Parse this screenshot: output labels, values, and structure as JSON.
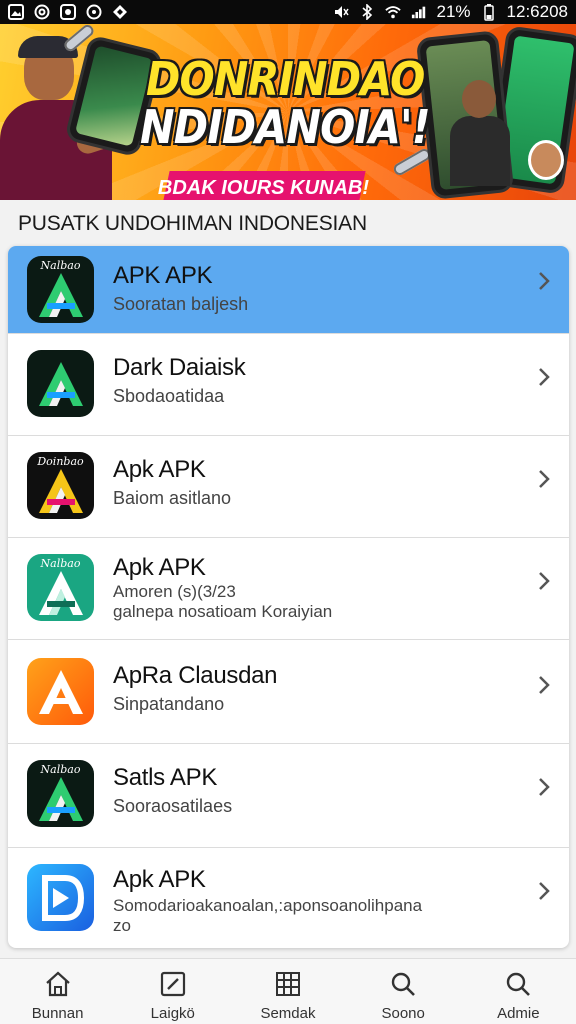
{
  "status_bar": {
    "left_icons": [
      "gallery-icon",
      "at-icon",
      "record-icon",
      "circle-icon",
      "diamond-icon"
    ],
    "battery_text": "21%",
    "time": "12:6208"
  },
  "banner": {
    "title_line1": "DONRINDAO",
    "title_line2": "NDIDANOIA'!",
    "pill_text": "BDAK IOURS KUNAB!"
  },
  "section": {
    "title": "PUSATK UNDOHIMAN INDONESIAN"
  },
  "apps": [
    {
      "name": "APK APK",
      "subtitle": "Sooratan baljesh",
      "icon_label": "Nalbao",
      "icon_bg": "#0b1a14",
      "selected": true
    },
    {
      "name": "Dark Daiaisk",
      "subtitle": "Sbodaoatidaa",
      "icon_label": "",
      "icon_bg": "#0b1a14",
      "selected": false
    },
    {
      "name": "Apk APK",
      "subtitle": "Baiom asitlano",
      "icon_label": "Doinbao",
      "icon_bg": "#0f0f0f",
      "selected": false
    },
    {
      "name": "Apk APK",
      "subtitle": "Amoren (s)(3/23\ngalnepa nosatioam Koraiyian",
      "icon_label": "Nalbao",
      "icon_bg": "#1aa682",
      "selected": false
    },
    {
      "name": "ApRa Clausdan",
      "subtitle": "Sinpatandano",
      "icon_label": "",
      "icon_bg": "#ff7a12",
      "selected": false
    },
    {
      "name": "Satls APK",
      "subtitle": "Sooraosatilaes",
      "icon_label": "Nalbao",
      "icon_bg": "#0b1a14",
      "selected": false
    },
    {
      "name": "Apk APK",
      "subtitle": "Somodarioakanoalan,:aponsoanolihpana\nzo",
      "icon_label": "",
      "icon_bg": "#1a8fe0",
      "selected": false
    }
  ],
  "nav": [
    {
      "label": "Bunnan",
      "icon": "home-icon"
    },
    {
      "label": "Laigkö",
      "icon": "edit-icon"
    },
    {
      "label": "Semdak",
      "icon": "grid-icon"
    },
    {
      "label": "Soono",
      "icon": "search-icon"
    },
    {
      "label": "Admie",
      "icon": "search-icon"
    }
  ],
  "colors": {
    "selected_row": "#5ca9f0",
    "banner_orange": "#ff7a12",
    "banner_pink": "#e6126e"
  }
}
